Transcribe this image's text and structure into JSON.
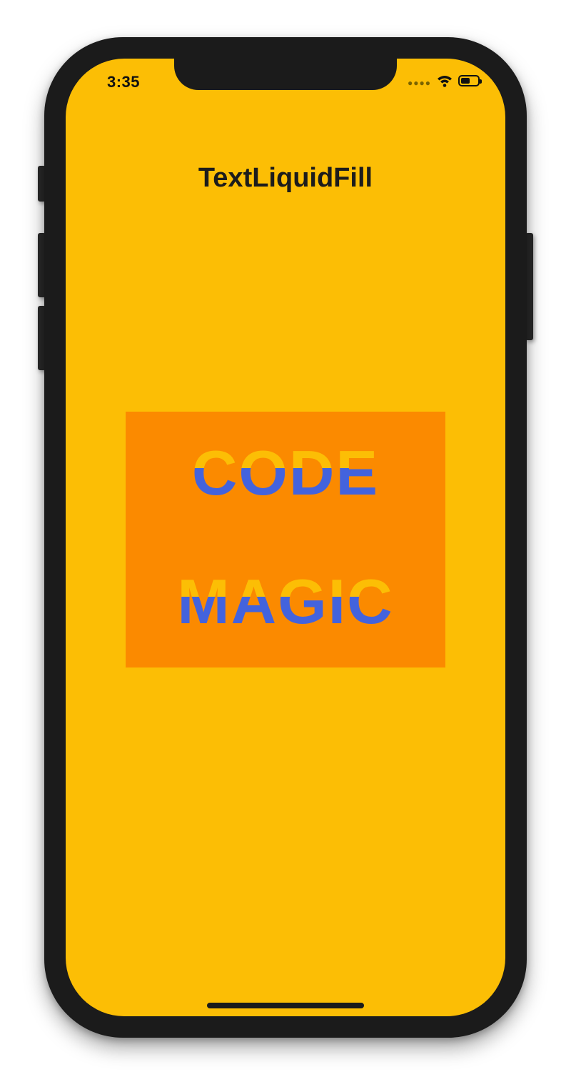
{
  "status_bar": {
    "time": "3:35",
    "signal_icon": "signal-dots-icon",
    "wifi_icon": "wifi-icon",
    "battery_icon": "battery-icon",
    "battery_level": 0.55
  },
  "header": {
    "title": "TextLiquidFill"
  },
  "liquid_text": {
    "lines": [
      "CODE",
      "MAGIC"
    ],
    "fill_level": 0.5
  },
  "colors": {
    "screen_background": "#FCBE05",
    "box_background": "#FB8A00",
    "liquid": "#4363DD",
    "frame": "#1B1B1B"
  }
}
